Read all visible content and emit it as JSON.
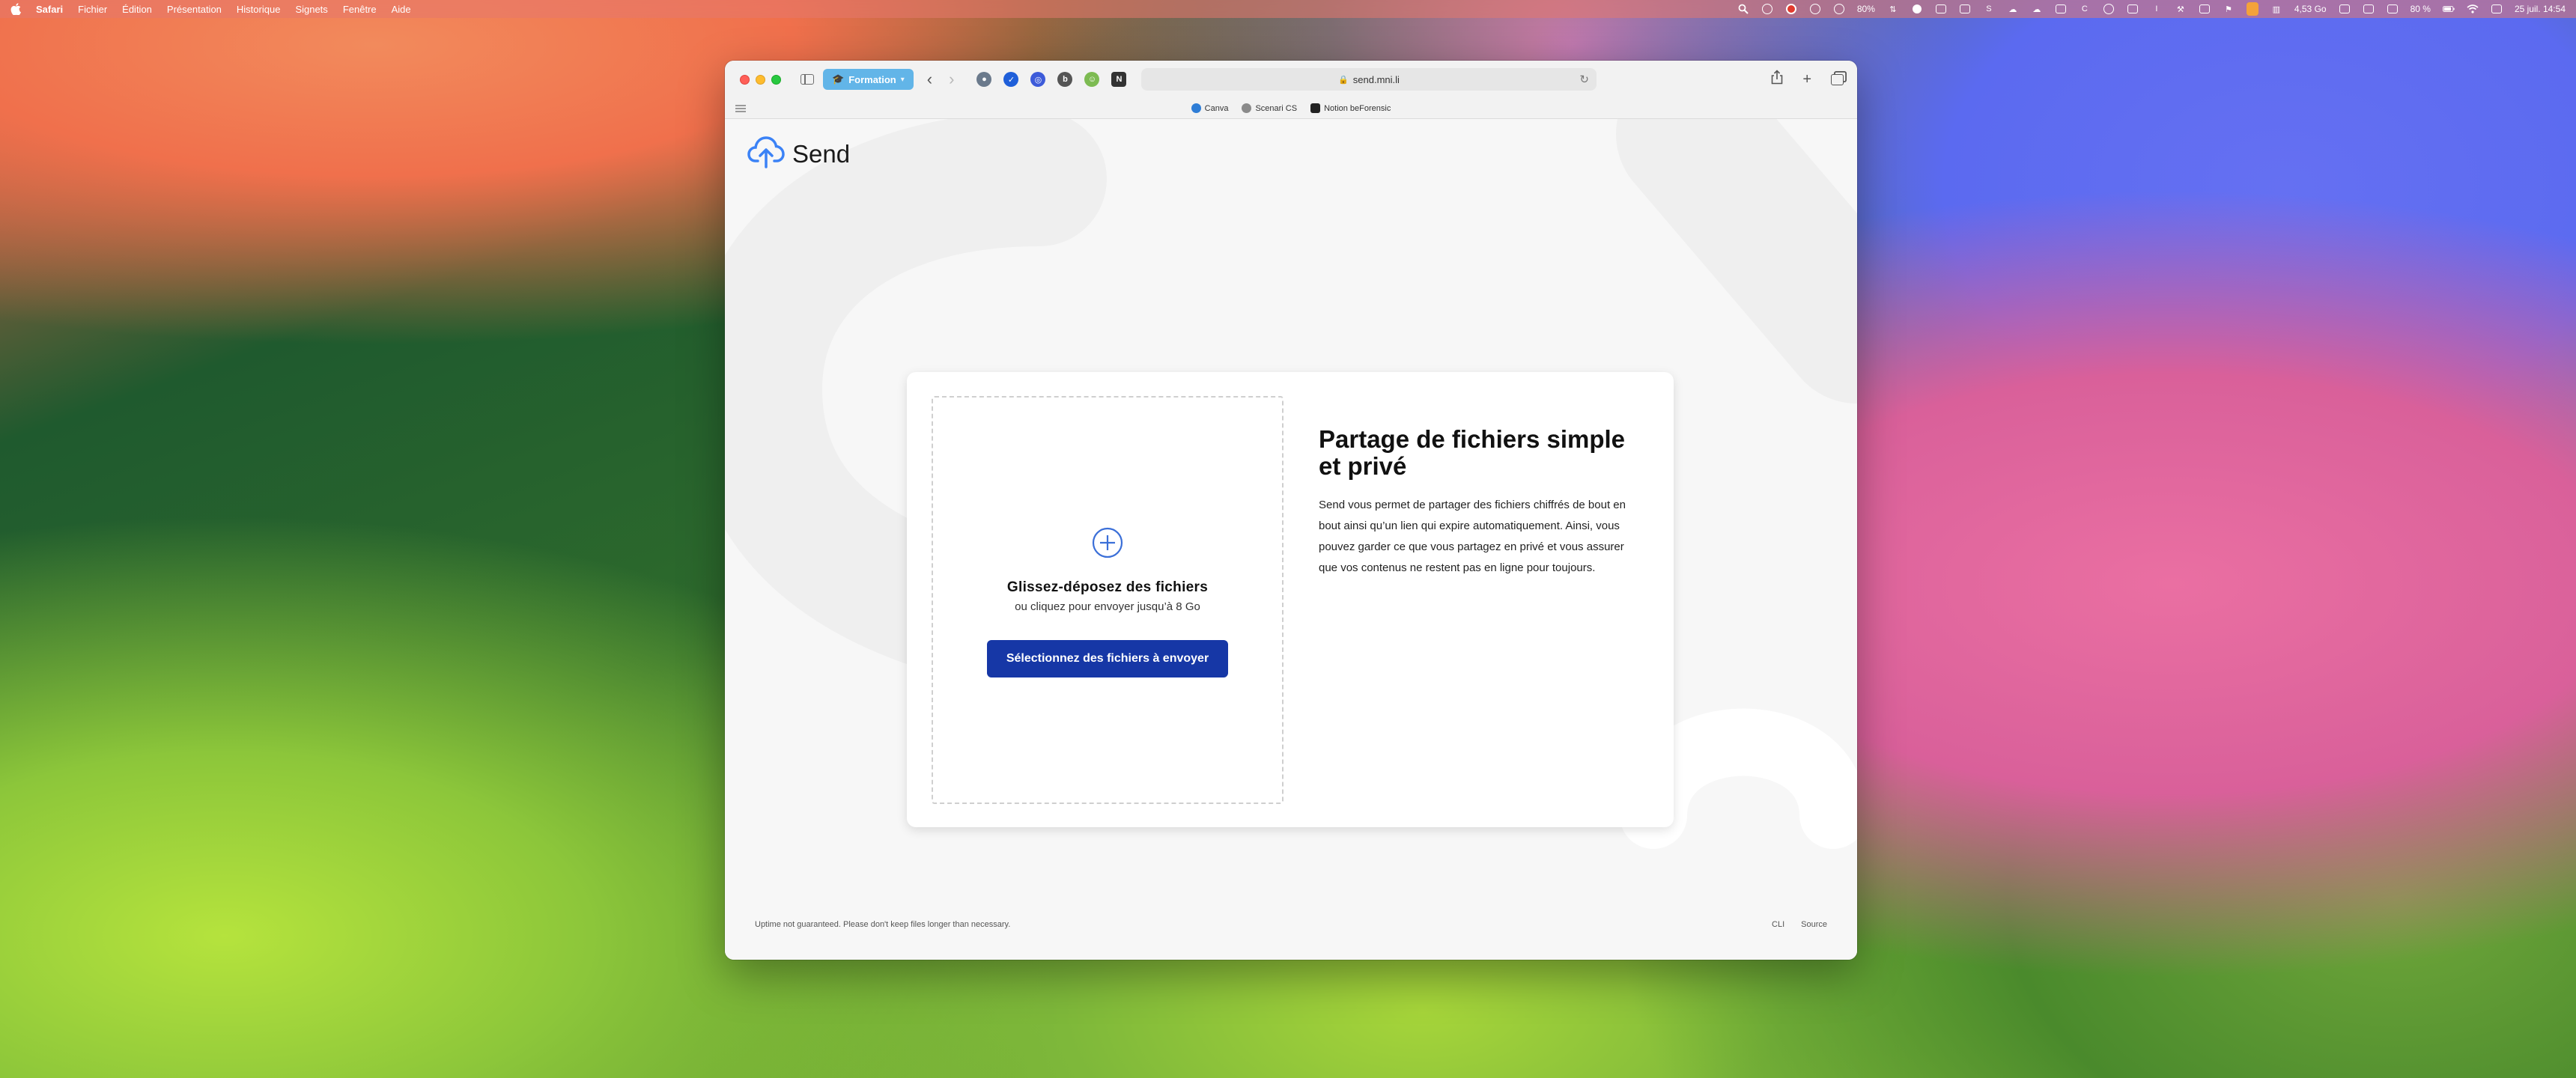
{
  "menubar": {
    "app_name": "Safari",
    "menus": [
      "Fichier",
      "Édition",
      "Présentation",
      "Historique",
      "Signets",
      "Fenêtre",
      "Aide"
    ],
    "status": {
      "cpu": "80%",
      "memory": "4,53 Go",
      "battery": "80 %",
      "datetime": "25 juil. 14:54"
    }
  },
  "browser": {
    "tab_group": "Formation",
    "url": "send.mni.li",
    "bookmarks": [
      {
        "label": "Canva",
        "color": "#2e7dd6"
      },
      {
        "label": "Scenari CS",
        "color": "#8a8a8a"
      },
      {
        "label": "Notion beForensic",
        "color": "#222222"
      }
    ]
  },
  "page": {
    "brand": "Send",
    "dropzone": {
      "title": "Glissez-déposez des fichiers",
      "subtitle": "ou cliquez pour envoyer jusqu’à 8 Go",
      "button": "Sélectionnez des fichiers à envoyer"
    },
    "intro": {
      "title": "Partage de fichiers simple et privé",
      "body": "Send vous permet de partager des fichiers chiffrés de bout en bout ainsi qu’un lien qui expire automatiquement. Ainsi, vous pouvez garder ce que vous partagez en privé et vous assurer que vos contenus ne restent pas en ligne pour toujours."
    },
    "footer": {
      "notice": "Uptime not guaranteed. Please don't keep files longer than necessary.",
      "links": [
        "CLI",
        "Source"
      ]
    }
  },
  "colors": {
    "accent": "#1637a6",
    "tab_group": "#62b5e8",
    "icon_blue": "#3b82f6"
  }
}
